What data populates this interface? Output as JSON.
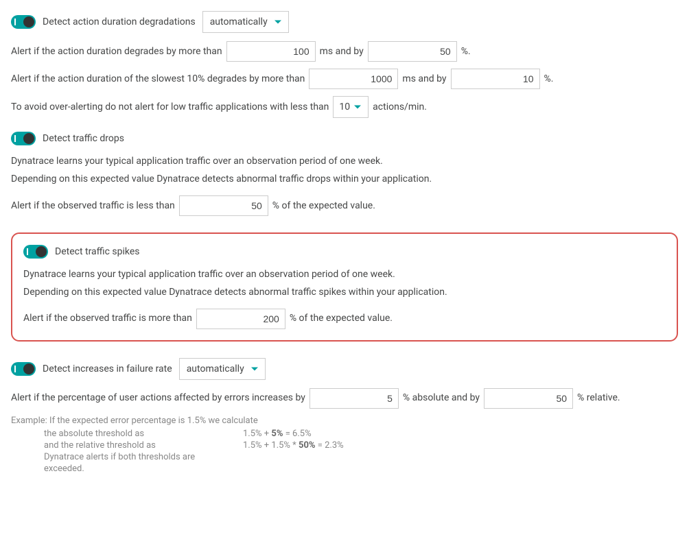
{
  "duration": {
    "title": "Detect action duration degradations",
    "mode": "automatically",
    "row1_pre": "Alert if the action duration degrades by more than",
    "row1_val1": "100",
    "row1_mid": "ms and by",
    "row1_val2": "50",
    "row1_post": "%.",
    "row2_pre": "Alert if the action duration of the slowest 10% degrades by more than",
    "row2_val1": "1000",
    "row2_mid": "ms and by",
    "row2_val2": "10",
    "row2_post": "%.",
    "row3_pre": "To avoid over-alerting do not alert for low traffic applications with less than",
    "row3_val": "10",
    "row3_post": "actions/min."
  },
  "drops": {
    "title": "Detect traffic drops",
    "desc1": "Dynatrace learns your typical application traffic over an observation period of one week.",
    "desc2": "Depending on this expected value Dynatrace detects abnormal traffic drops within your application.",
    "row_pre": "Alert if the observed traffic is less than",
    "row_val": "50",
    "row_post": "% of the expected value."
  },
  "spikes": {
    "title": "Detect traffic spikes",
    "desc1": "Dynatrace learns your typical application traffic over an observation period of one week.",
    "desc2": "Depending on this expected value Dynatrace detects abnormal traffic spikes within your application.",
    "row_pre": "Alert if the observed traffic is more than",
    "row_val": "200",
    "row_post": "% of the expected value."
  },
  "failure": {
    "title": "Detect increases in failure rate",
    "mode": "automatically",
    "row_pre": "Alert if the percentage of user actions affected by errors increases by",
    "row_val1": "5",
    "row_mid": "% absolute and by",
    "row_val2": "50",
    "row_post": "% relative.",
    "example_header": "Example: If the expected error percentage is 1.5% we calculate",
    "abs_label": "the absolute threshold as",
    "abs_pre": "1.5% + ",
    "abs_bold": "5%",
    "abs_post": " = 6.5%",
    "rel_label": "and the relative threshold as",
    "rel_pre": "1.5% + 1.5% * ",
    "rel_bold": "50%",
    "rel_post": " = 2.3%",
    "exceed1": "Dynatrace alerts if both thresholds are",
    "exceed2": "exceeded."
  }
}
